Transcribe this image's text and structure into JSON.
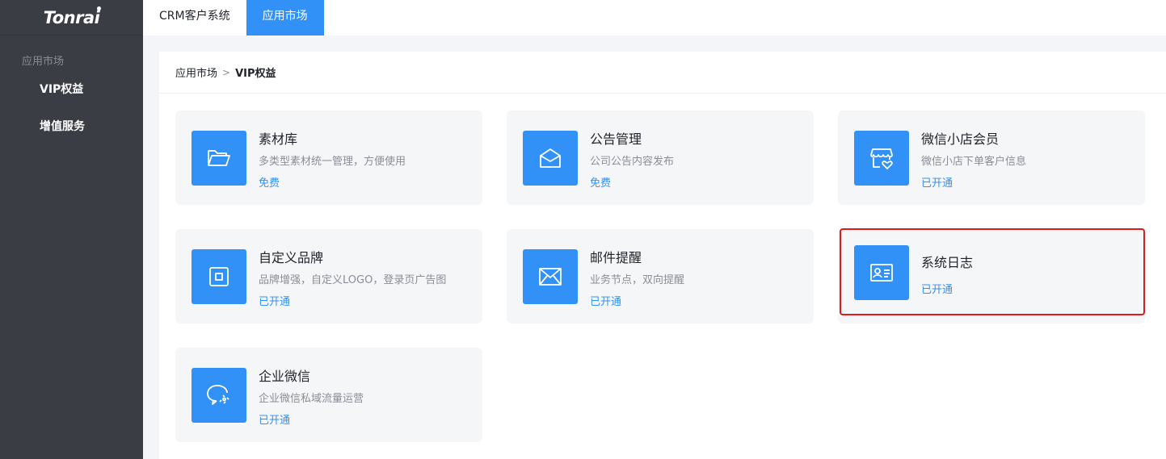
{
  "sidebar": {
    "logo": "Tonrai",
    "group_label": "应用市场",
    "items": [
      {
        "label": "VIP权益"
      },
      {
        "label": "增值服务"
      }
    ]
  },
  "topbar": {
    "tabs": [
      {
        "label": "CRM客户系统",
        "active": false
      },
      {
        "label": "应用市场",
        "active": true
      }
    ]
  },
  "breadcrumb": {
    "root": "应用市场",
    "separator": ">",
    "current": "VIP权益"
  },
  "cards": [
    {
      "title": "素材库",
      "desc": "多类型素材统一管理，方便使用",
      "status": "免费",
      "icon": "folder-icon"
    },
    {
      "title": "公告管理",
      "desc": "公司公告内容发布",
      "status": "免费",
      "icon": "envelope-open-icon"
    },
    {
      "title": "微信小店会员",
      "desc": "微信小店下单客户信息",
      "status": "已开通",
      "icon": "shop-heart-icon"
    },
    {
      "title": "自定义品牌",
      "desc": "品牌增强，自定义LOGO，登录页广告图",
      "status": "已开通",
      "icon": "brand-square-icon"
    },
    {
      "title": "邮件提醒",
      "desc": "业务节点，双向提醒",
      "status": "已开通",
      "icon": "mail-icon"
    },
    {
      "title": "系统日志",
      "desc": "",
      "status": "已开通",
      "icon": "id-card-icon"
    },
    {
      "title": "企业微信",
      "desc": "企业微信私域流量运营",
      "status": "已开通",
      "icon": "chat-bubble-icon"
    }
  ],
  "colors": {
    "accent": "#3191f6",
    "sidebar_bg": "#3b3d45",
    "highlight_border": "#e01a1a"
  }
}
